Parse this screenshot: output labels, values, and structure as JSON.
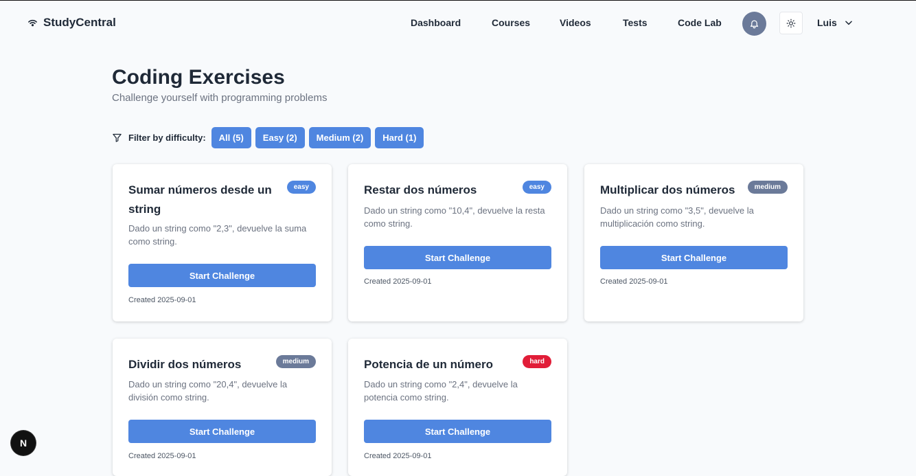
{
  "brand": {
    "name": "StudyCentral"
  },
  "nav": {
    "links": [
      "Dashboard",
      "Courses",
      "Videos",
      "Tests",
      "Code Lab"
    ],
    "user_name": "Luis"
  },
  "page": {
    "title": "Coding Exercises",
    "subtitle": "Challenge yourself with programming problems"
  },
  "filter": {
    "label": "Filter by difficulty:",
    "options": [
      "All (5)",
      "Easy (2)",
      "Medium (2)",
      "Hard (1)"
    ]
  },
  "exercises": [
    {
      "title": "Sumar números desde un string",
      "difficulty": "easy",
      "description": "Dado un string como \"2,3\", devuelve la suma como string.",
      "button": "Start Challenge",
      "created": "Created 2025-09-01"
    },
    {
      "title": "Restar dos números",
      "difficulty": "easy",
      "description": "Dado un string como \"10,4\", devuelve la resta como string.",
      "button": "Start Challenge",
      "created": "Created 2025-09-01"
    },
    {
      "title": "Multiplicar dos números",
      "difficulty": "medium",
      "description": "Dado un string como \"3,5\", devuelve la multiplicación como string.",
      "button": "Start Challenge",
      "created": "Created 2025-09-01"
    },
    {
      "title": "Dividir dos números",
      "difficulty": "medium",
      "description": "Dado un string como \"20,4\", devuelve la división como string.",
      "button": "Start Challenge",
      "created": "Created 2025-09-01"
    },
    {
      "title": "Potencia de un número",
      "difficulty": "hard",
      "description": "Dado un string como \"2,4\", devuelve la potencia como string.",
      "button": "Start Challenge",
      "created": "Created 2025-09-01"
    }
  ],
  "fab": {
    "letter": "N"
  },
  "colors": {
    "accent": "#4f86e0",
    "medium": "#6b7a99",
    "hard": "#e11d38",
    "background": "#f8fafc"
  }
}
